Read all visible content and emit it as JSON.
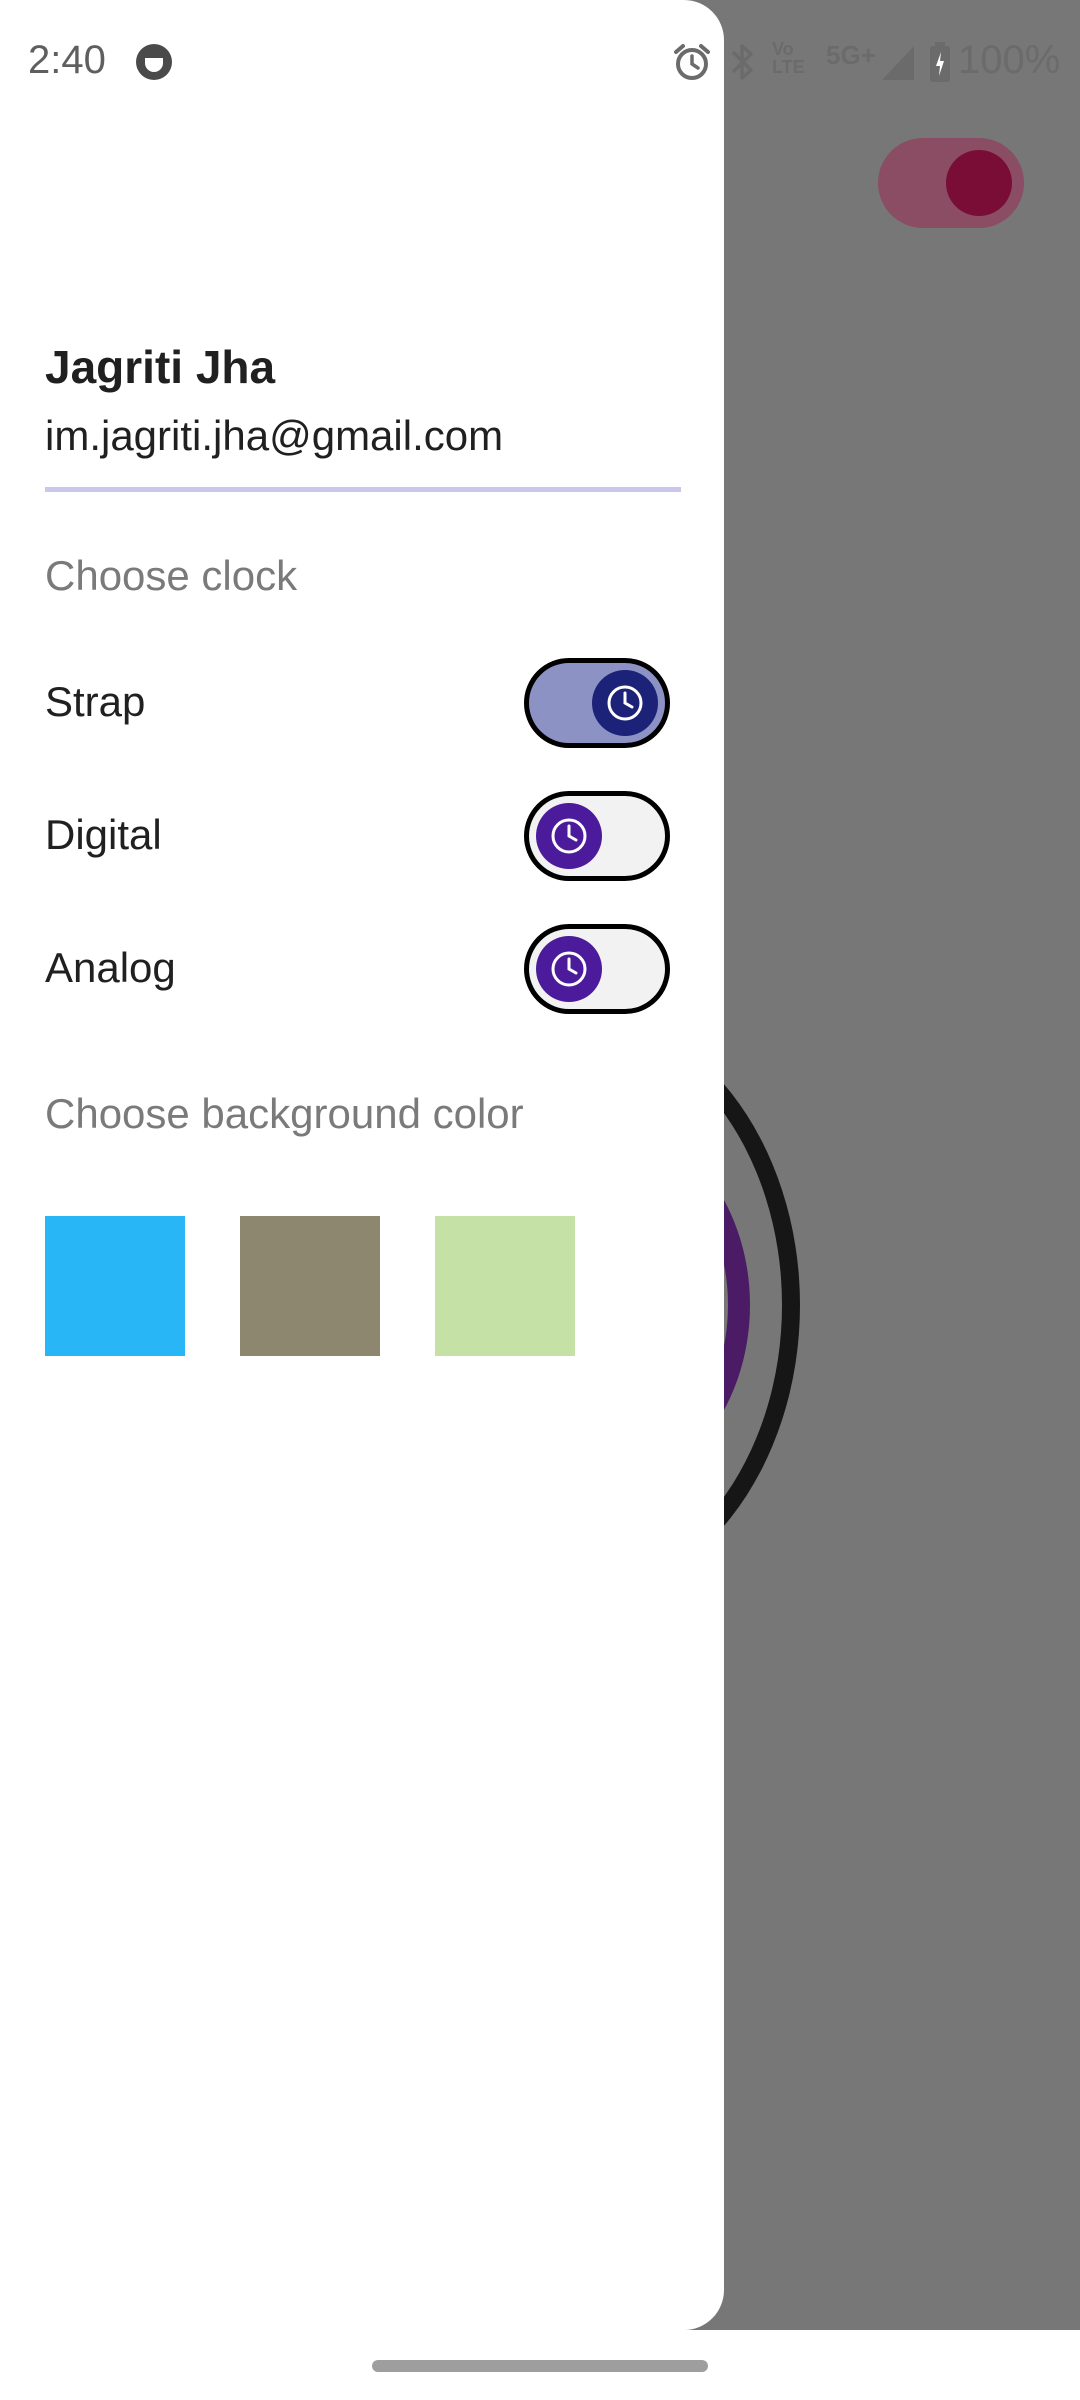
{
  "status_bar": {
    "time": "2:40",
    "net_label": "5G+",
    "volte_label": "Vo LTE",
    "battery_percent": "100%",
    "icons": [
      "face-icon",
      "alarm-icon",
      "bluetooth-icon",
      "volte-icon",
      "5g-icon",
      "signal-icon",
      "battery-icon"
    ]
  },
  "drawer": {
    "user_name": "Jagriti Jha",
    "user_email": "im.jagriti.jha@gmail.com",
    "clock_section_title": "Choose clock",
    "clock_options": [
      {
        "label": "Strap",
        "enabled": true
      },
      {
        "label": "Digital",
        "enabled": false
      },
      {
        "label": "Analog",
        "enabled": false
      }
    ],
    "background_section_title": "Choose background color",
    "background_colors": [
      "#29b6f6",
      "#8d8770",
      "#c5e1a5"
    ]
  },
  "colors": {
    "switch_on_track": "#8d92c4",
    "switch_on_thumb": "#1c2278",
    "switch_off_thumb": "#4b1b9c",
    "divider": "#c9c7ec",
    "scrim": "#777777"
  }
}
